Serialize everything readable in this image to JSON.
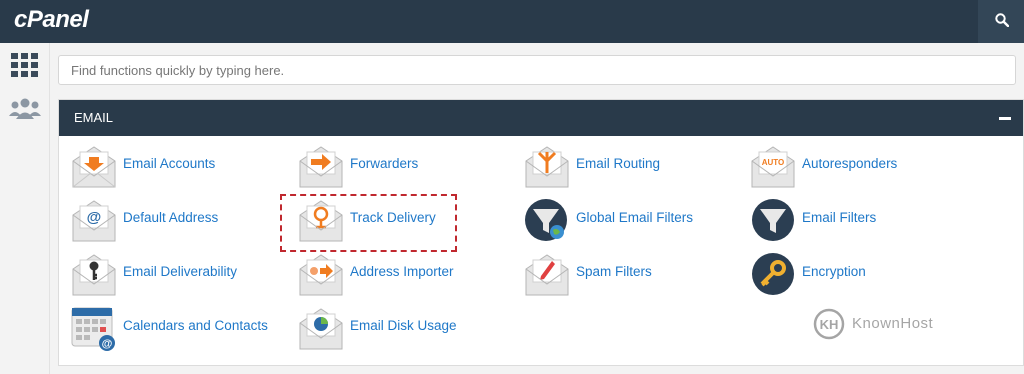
{
  "app": {
    "logo_text": "cPanel"
  },
  "header": {
    "search_icon": "search-icon"
  },
  "sidebar": {
    "items": [
      {
        "name": "grid-icon"
      },
      {
        "name": "users-icon"
      }
    ]
  },
  "search": {
    "placeholder": "Find functions quickly by typing here."
  },
  "email_panel": {
    "title": "EMAIL",
    "collapse_icon": "minus-icon",
    "items": [
      {
        "label": "Email Accounts",
        "icon": "email-accounts-icon"
      },
      {
        "label": "Forwarders",
        "icon": "forwarders-icon"
      },
      {
        "label": "Email Routing",
        "icon": "email-routing-icon"
      },
      {
        "label": "Autoresponders",
        "icon": "autoresponders-icon",
        "icon_text": "AUTO"
      },
      {
        "label": "Default Address",
        "icon": "default-address-icon",
        "icon_text": "@"
      },
      {
        "label": "Track Delivery",
        "icon": "track-delivery-icon"
      },
      {
        "label": "Global Email Filters",
        "icon": "global-email-filters-icon"
      },
      {
        "label": "Email Filters",
        "icon": "email-filters-icon"
      },
      {
        "label": "Email Deliverability",
        "icon": "email-deliverability-icon"
      },
      {
        "label": "Address Importer",
        "icon": "address-importer-icon"
      },
      {
        "label": "Spam Filters",
        "icon": "spam-filters-icon"
      },
      {
        "label": "Encryption",
        "icon": "encryption-icon"
      },
      {
        "label": "Calendars and Contacts",
        "icon": "calendars-contacts-icon",
        "icon_text": "@"
      },
      {
        "label": "Email Disk Usage",
        "icon": "email-disk-usage-icon"
      }
    ]
  },
  "watermark": {
    "logo_text": "KH",
    "text": "KnownHost"
  },
  "colors": {
    "topbar": "#293a4a",
    "link": "#1f78c8",
    "accent_orange": "#f07c20",
    "highlight": "#c0282e"
  }
}
